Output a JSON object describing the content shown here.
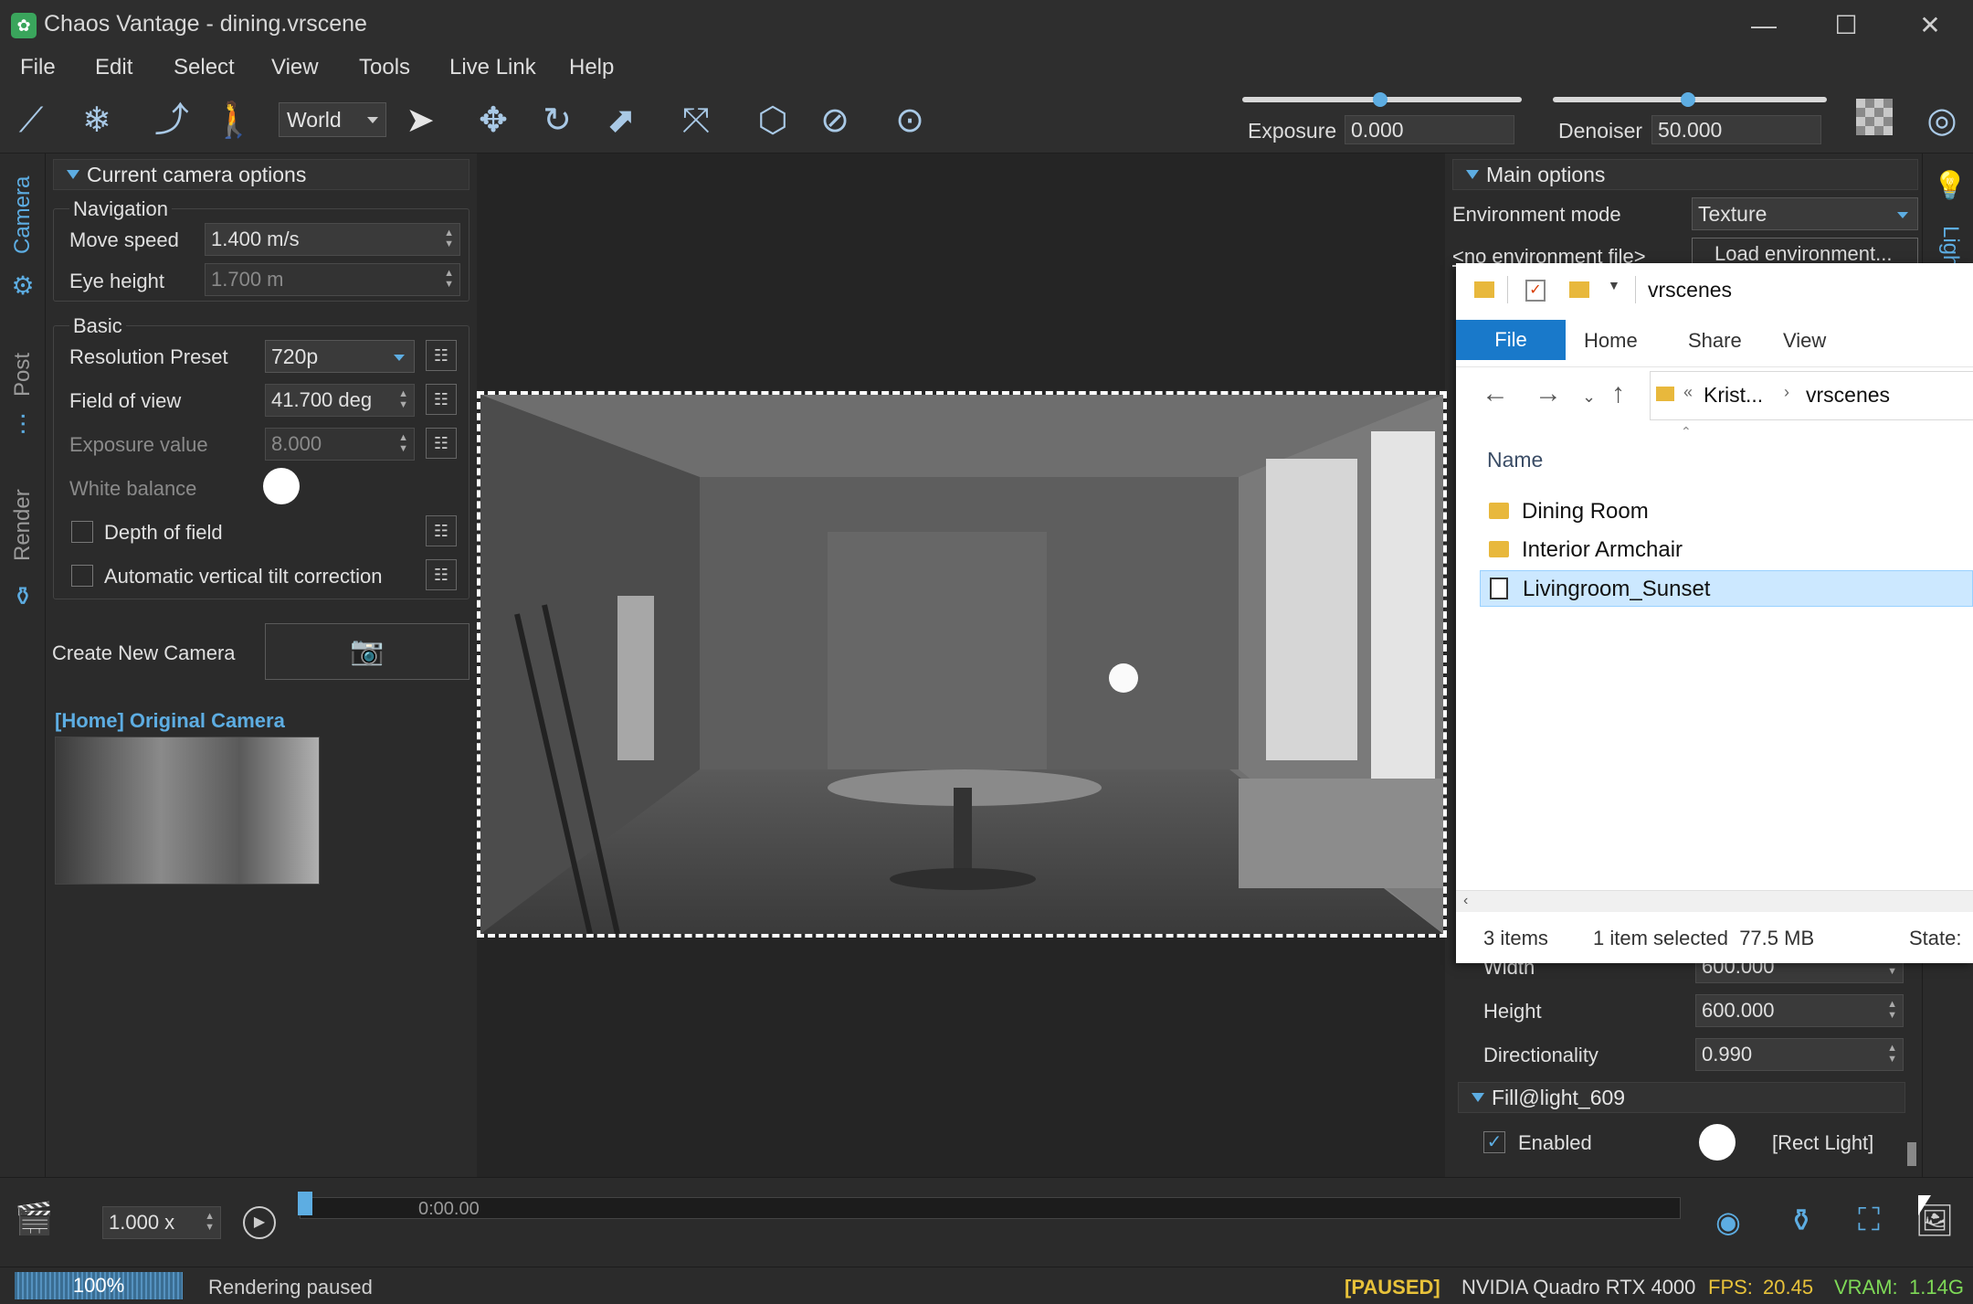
{
  "window": {
    "title": "Chaos Vantage - dining.vrscene",
    "minimize": "—",
    "maximize": "☐",
    "close": "✕"
  },
  "menu": [
    "File",
    "Edit",
    "Select",
    "View",
    "Tools",
    "Live Link",
    "Help"
  ],
  "toolbar": {
    "space_select": "World",
    "exposure_label": "Exposure",
    "exposure_value": "0.000",
    "denoiser_label": "Denoiser",
    "denoiser_value": "50.000"
  },
  "left_tabs": [
    "Camera",
    "Post",
    "Render"
  ],
  "camera_panel": {
    "header": "Current camera options",
    "navigation_title": "Navigation",
    "move_speed_label": "Move speed",
    "move_speed_value": "1.400 m/s",
    "eye_height_label": "Eye height",
    "eye_height_value": "1.700 m",
    "basic_title": "Basic",
    "resolution_label": "Resolution Preset",
    "resolution_value": "720p",
    "fov_label": "Field of view",
    "fov_value": "41.700 deg",
    "exposure_label": "Exposure value",
    "exposure_value": "8.000",
    "white_balance_label": "White balance",
    "dof_label": "Depth of field",
    "tilt_label": "Automatic vertical tilt correction",
    "create_camera_label": "Create New Camera",
    "camera_name": "[Home] Original Camera"
  },
  "right_panel": {
    "header": "Main options",
    "env_mode_label": "Environment mode",
    "env_mode_value": "Texture",
    "env_file_link": "<no environment file>",
    "load_env_button": "Load environment...",
    "width_label": "Width",
    "width_value": "600.000",
    "height_label": "Height",
    "height_value": "600.000",
    "directionality_label": "Directionality",
    "directionality_value": "0.990",
    "fill_light_header": "Fill@light_609",
    "enabled_label": "Enabled",
    "light_type": "[Rect Light]",
    "tab_label": "Ligh"
  },
  "explorer": {
    "title": "vrscenes",
    "tabs": [
      "File",
      "Home",
      "Share",
      "View"
    ],
    "breadcrumb_prev": "Krist...",
    "breadcrumb_current": "vrscenes",
    "column_name": "Name",
    "items": [
      {
        "name": "Dining Room",
        "type": "folder"
      },
      {
        "name": "Interior Armchair",
        "type": "folder"
      },
      {
        "name": "Livingroom_Sunset",
        "type": "file"
      }
    ],
    "status_count": "3 items",
    "status_selected": "1 item selected  77.5 MB",
    "status_state": "State:"
  },
  "timeline": {
    "speed": "1.000 x",
    "time": "0:00.00"
  },
  "status": {
    "progress": "100%",
    "progress_fraction": 1.0,
    "message": "Rendering paused",
    "paused": "[PAUSED]",
    "gpu": "NVIDIA Quadro RTX 4000",
    "fps_label": "FPS:",
    "fps_value": "20.45",
    "vram_label": "VRAM:",
    "vram_value": "1.14G"
  },
  "colors": {
    "accent": "#5dade2",
    "paused": "#e8c23a",
    "stats": "#7ed957",
    "explorer_file_tab": "#1979ca"
  }
}
